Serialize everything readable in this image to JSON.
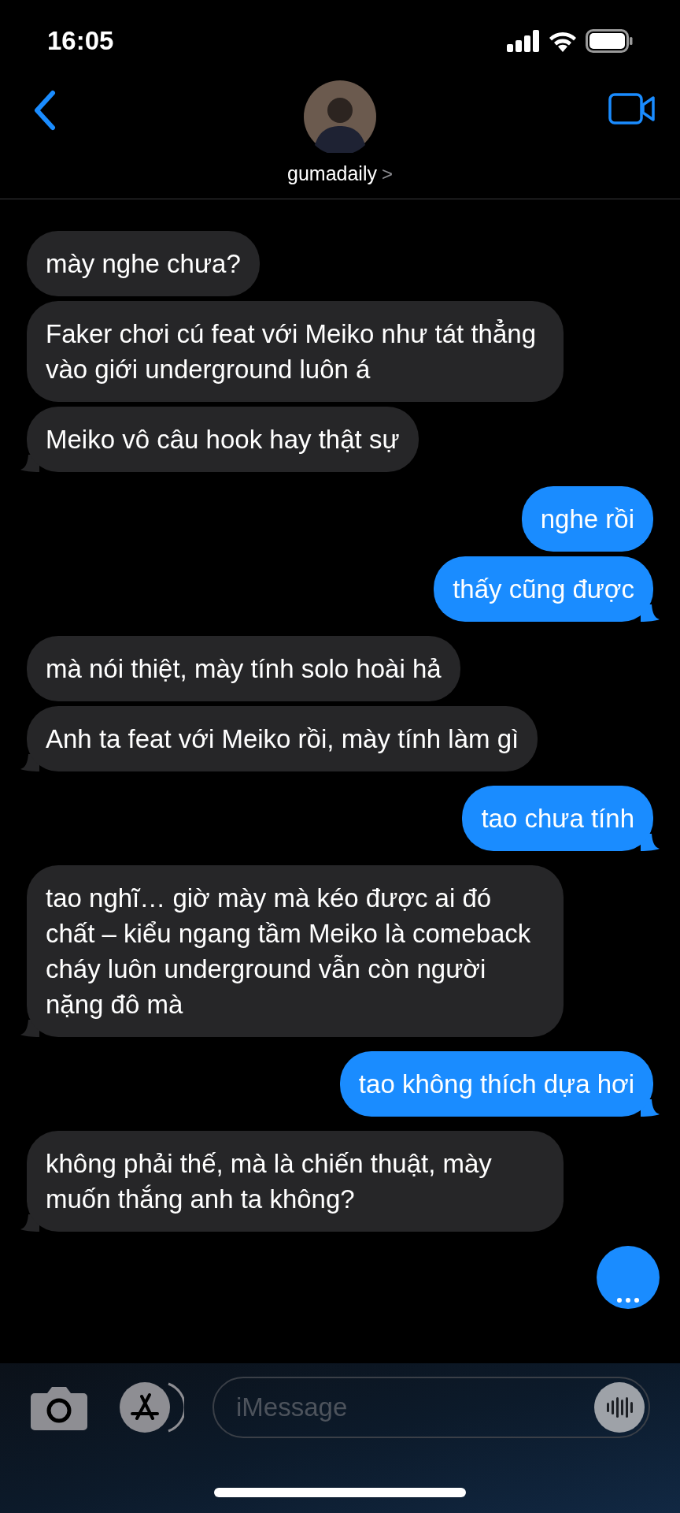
{
  "status_bar": {
    "time": "16:05"
  },
  "header": {
    "contact_name": "gumadaily",
    "chevron": ">"
  },
  "messages": [
    {
      "kind": "received",
      "text": "mày nghe chưa?"
    },
    {
      "kind": "received",
      "text": "Faker chơi cú feat với Meiko như tát thẳng vào giới underground luôn á"
    },
    {
      "kind": "received",
      "text": "Meiko vô câu hook hay thật sự"
    },
    {
      "kind": "sent",
      "text": "nghe rồi"
    },
    {
      "kind": "sent",
      "text": "thấy cũng được"
    },
    {
      "kind": "received",
      "text": "mà nói thiệt, mày tính solo hoài hả"
    },
    {
      "kind": "received",
      "text": "Anh ta feat với Meiko rồi, mày tính làm gì"
    },
    {
      "kind": "sent",
      "text": "tao chưa tính"
    },
    {
      "kind": "received",
      "text": "tao nghĩ… giờ mày mà kéo được ai đó chất – kiểu ngang tầm Meiko là comeback cháy luôn underground vẫn còn người nặng đô mà"
    },
    {
      "kind": "sent",
      "text": "tao không thích dựa hơi"
    },
    {
      "kind": "received",
      "text": "không phải thế, mà là chiến thuật, mày muốn thắng anh ta không?"
    },
    {
      "kind": "typing"
    }
  ],
  "composer": {
    "placeholder": "iMessage"
  }
}
